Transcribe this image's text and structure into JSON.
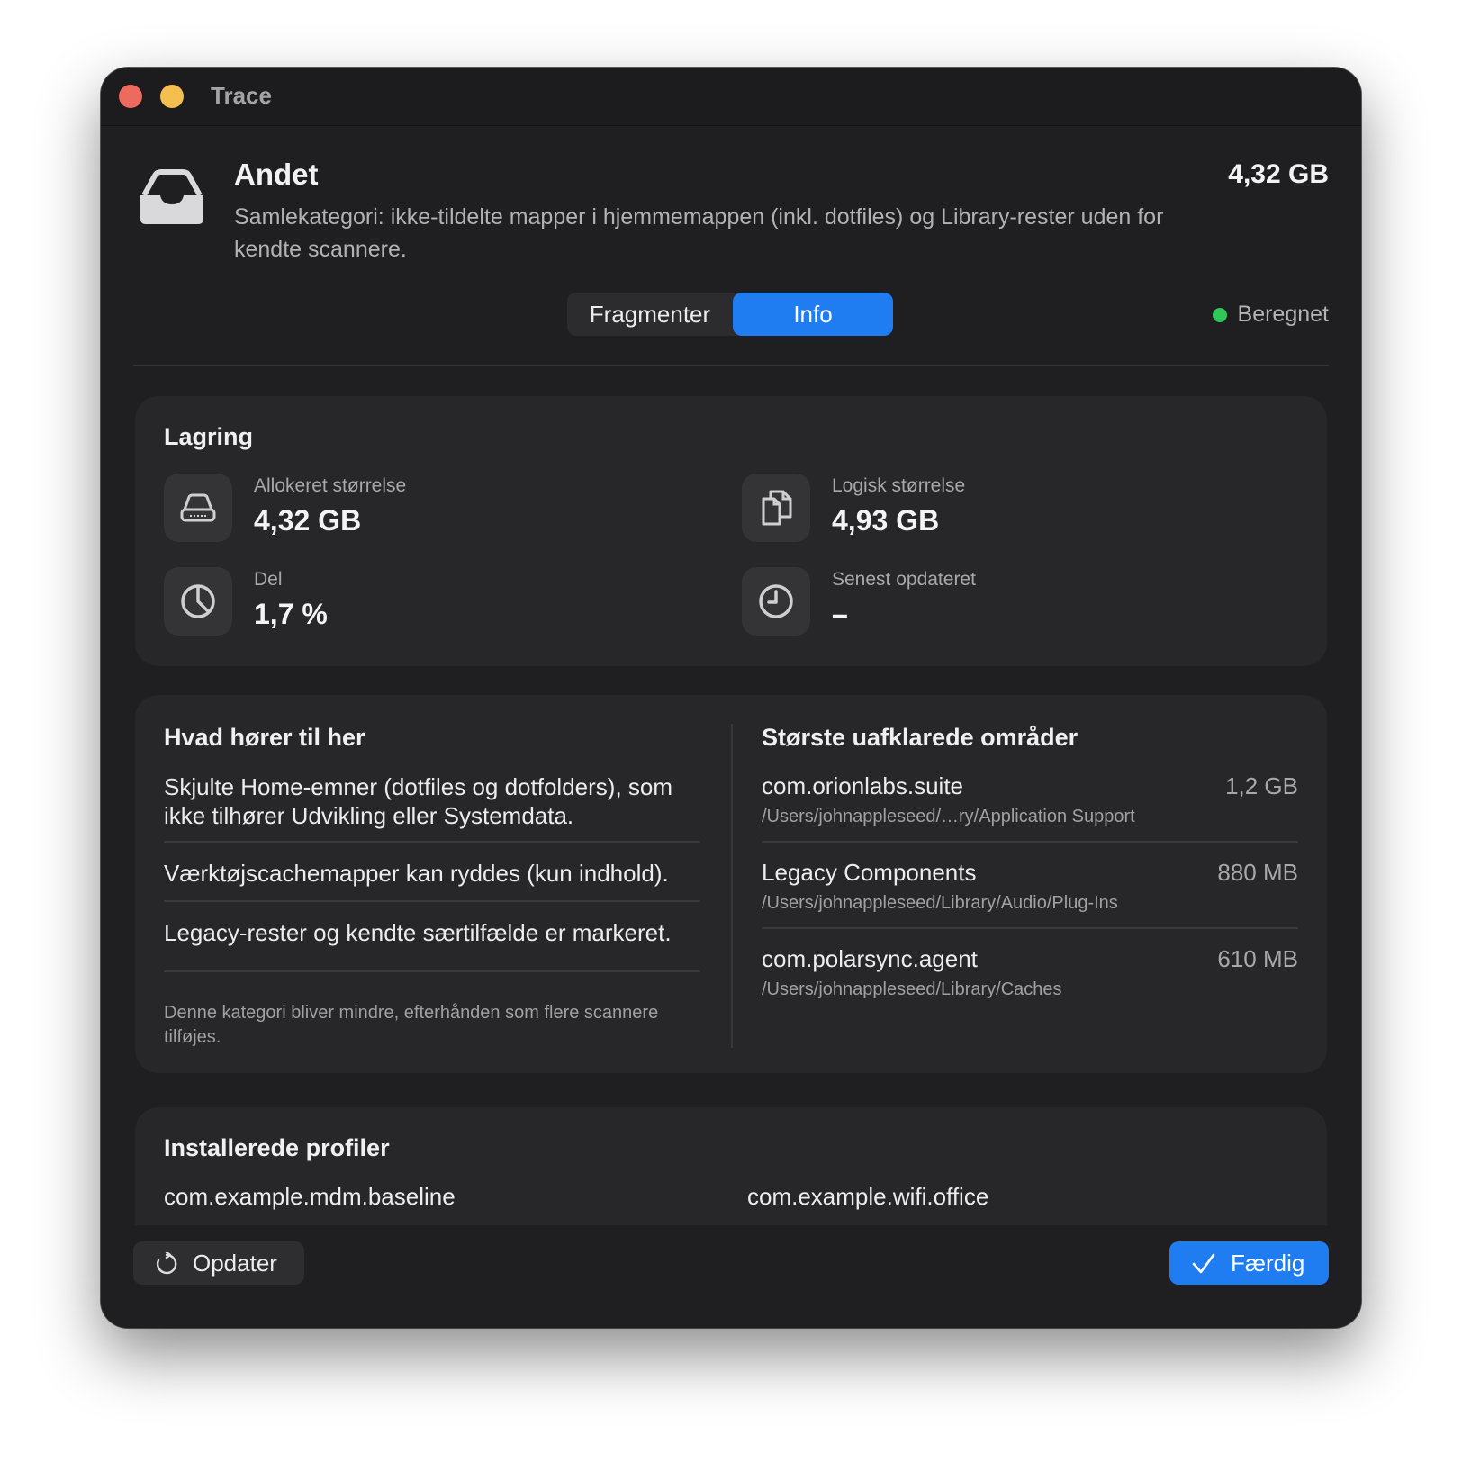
{
  "window": {
    "title": "Trace"
  },
  "header": {
    "icon": "tray-icon",
    "title": "Andet",
    "description": "Samlekategori: ikke-tildelte mapper i hjemmemappen (inkl. dotfiles) og Library-rester uden for kendte scannere.",
    "size": "4,32 GB"
  },
  "tabs": [
    {
      "label": "Fragmenter",
      "selected": false
    },
    {
      "label": "Info",
      "selected": true
    }
  ],
  "status": {
    "label": "Beregnet",
    "color": "#31c759"
  },
  "storage": {
    "title": "Lagring",
    "stats": [
      {
        "label": "Allokeret størrelse",
        "value": "4,32 GB",
        "icon": "drive-icon"
      },
      {
        "label": "Logisk størrelse",
        "value": "4,93 GB",
        "icon": "documents-icon"
      },
      {
        "label": "Del",
        "value": "1,7 %",
        "icon": "pie-chart-icon"
      },
      {
        "label": "Senest opdateret",
        "value": "–",
        "icon": "clock-icon"
      }
    ]
  },
  "belongs": {
    "title": "Hvad hører til her",
    "items": [
      "Skjulte Home-emner (dotfiles og dotfolders), som ikke tilhører Udvikling eller Systemdata.",
      "Værktøjscachemapper kan ryddes (kun indhold).",
      "Legacy-rester og kendte særtilfælde er markeret."
    ],
    "note": "Denne kategori bliver mindre, efterhånden som flere scannere tilføjes."
  },
  "largest": {
    "title": "Største uafklarede områder",
    "items": [
      {
        "name": "com.orionlabs.suite",
        "size": "1,2 GB",
        "path": "/Users/johnappleseed/…ry/Application Support"
      },
      {
        "name": "Legacy Components",
        "size": "880 MB",
        "path": "/Users/johnappleseed/Library/Audio/Plug-Ins"
      },
      {
        "name": "com.polarsync.agent",
        "size": "610 MB",
        "path": "/Users/johnappleseed/Library/Caches"
      }
    ]
  },
  "profiles": {
    "title": "Installerede profiler",
    "items": [
      "com.example.mdm.baseline",
      "com.example.wifi.office"
    ]
  },
  "footer": {
    "update_label": "Opdater",
    "done_label": "Færdig"
  },
  "colors": {
    "accent": "#1f7cf1",
    "window_bg": "#1f1f21",
    "card_bg": "#272729"
  }
}
